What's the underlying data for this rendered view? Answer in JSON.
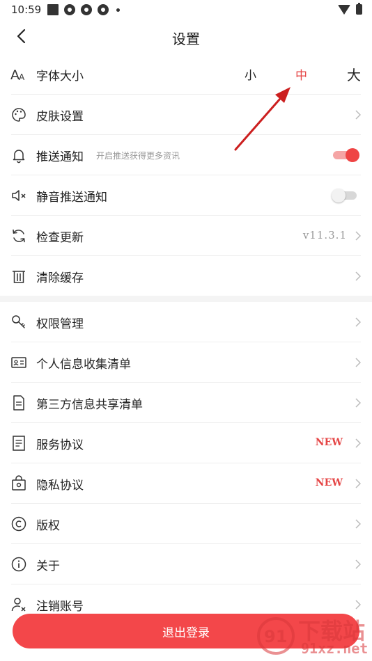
{
  "status_bar": {
    "time": "10:59"
  },
  "header": {
    "title": "设置"
  },
  "font_size": {
    "label": "字体大小",
    "options": [
      "小",
      "中",
      "大"
    ],
    "selected": "中"
  },
  "settings": {
    "skin": {
      "label": "皮肤设置"
    },
    "push": {
      "label": "推送通知",
      "hint": "开启推送获得更多资讯",
      "enabled": true
    },
    "silent_push": {
      "label": "静音推送通知",
      "enabled": false
    },
    "update": {
      "label": "检查更新",
      "version": "v11.3.1"
    },
    "cache": {
      "label": "清除缓存"
    }
  },
  "legal": {
    "permissions": {
      "label": "权限管理"
    },
    "personal_info": {
      "label": "个人信息收集清单"
    },
    "third_party": {
      "label": "第三方信息共享清单"
    },
    "service": {
      "label": "服务协议",
      "badge": "NEW"
    },
    "privacy": {
      "label": "隐私协议",
      "badge": "NEW"
    },
    "copyright": {
      "label": "版权"
    },
    "about": {
      "label": "关于"
    },
    "cancel_account": {
      "label": "注销账号"
    }
  },
  "logout": {
    "label": "退出登录"
  },
  "watermark": {
    "line1": "下载站",
    "line2": "91xz.net"
  },
  "colors": {
    "accent": "#ef4444",
    "logout_bg": "#f3474a",
    "toggle_on_track": "#f5a5a5",
    "annotation_arrow": "#cc1f1f"
  }
}
